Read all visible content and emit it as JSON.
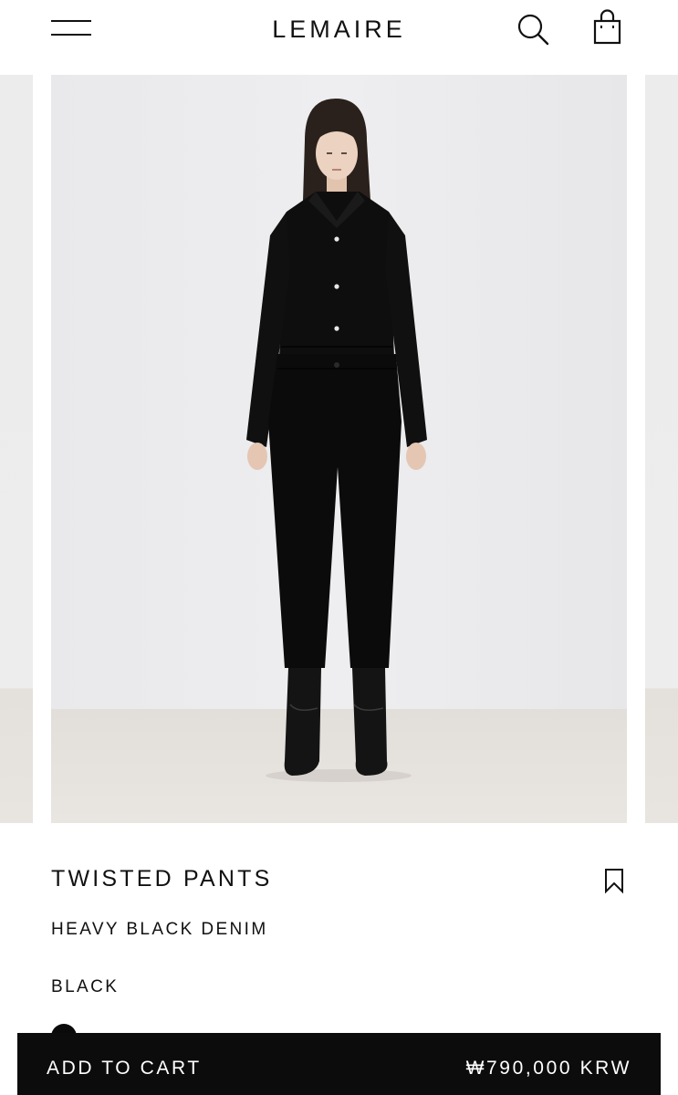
{
  "header": {
    "brand": "LEMAIRE",
    "menu_icon": "hamburger-menu-icon",
    "search_icon": "search-icon",
    "bag_icon": "shopping-bag-icon"
  },
  "gallery": {
    "main_image": "product-photo-model-black-denim"
  },
  "product": {
    "name": "TWISTED PANTS",
    "material": "HEAVY BLACK DENIM",
    "color": "BLACK",
    "wishlist_icon": "bookmark-icon",
    "swatch_color": "#0a0a0a"
  },
  "cart": {
    "label": "ADD TO CART",
    "price": "₩790,000 KRW"
  },
  "colors": {
    "background": "#ffffff",
    "text": "#111111",
    "cart_bar": "#0c0c0c",
    "cart_text": "#ffffff"
  }
}
